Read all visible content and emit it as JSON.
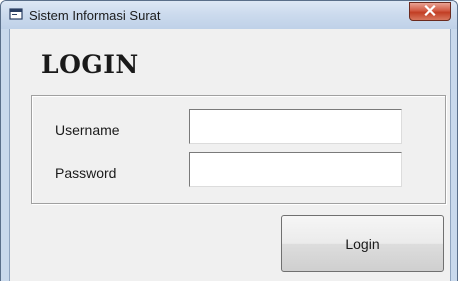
{
  "window": {
    "title": "Sistem Informasi Surat"
  },
  "form": {
    "heading": "LOGIN",
    "username_label": "Username",
    "username_value": "",
    "password_label": "Password",
    "password_value": "",
    "login_button": "Login"
  },
  "icons": {
    "app": "window-icon",
    "close": "close-icon"
  },
  "colors": {
    "close_button": "#c94a32",
    "titlebar": "#cbdaed",
    "client": "#f0f0f0"
  }
}
